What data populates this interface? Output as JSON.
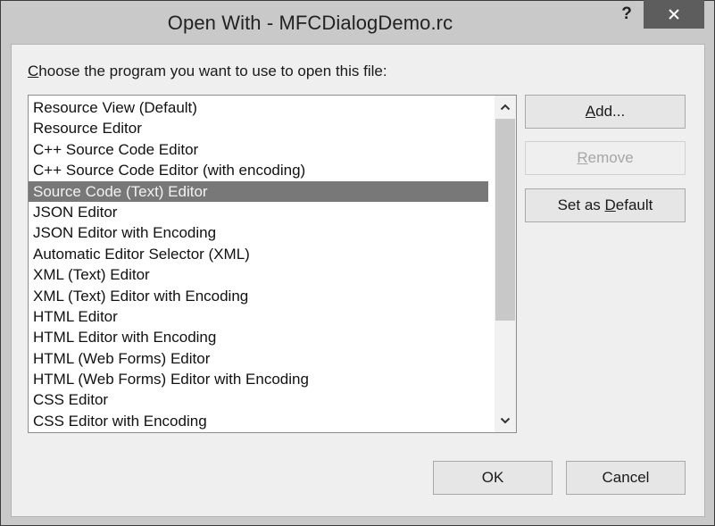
{
  "window": {
    "title": "Open With - MFCDialogDemo.rc",
    "help_label": "?",
    "close_icon": "close-icon"
  },
  "prompt": {
    "accelerator": "C",
    "rest": "hoose the program you want to use to open this file:"
  },
  "list": {
    "selected_index": 4,
    "items": [
      "Resource View (Default)",
      "Resource Editor",
      "C++ Source Code Editor",
      "C++ Source Code Editor (with encoding)",
      "Source Code (Text) Editor",
      "JSON Editor",
      "JSON Editor with Encoding",
      "Automatic Editor Selector (XML)",
      "XML (Text) Editor",
      "XML (Text) Editor with Encoding",
      "HTML Editor",
      "HTML Editor with Encoding",
      "HTML (Web Forms) Editor",
      "HTML (Web Forms) Editor with Encoding",
      "CSS Editor",
      "CSS Editor with Encoding"
    ],
    "scroll": {
      "up_icon": "chevron-up-icon",
      "down_icon": "chevron-down-icon",
      "thumb_start_fraction": 0.0,
      "visible_fraction": 0.7
    }
  },
  "buttons": {
    "add": {
      "accel": "A",
      "rest": "dd...",
      "enabled": true
    },
    "remove": {
      "accel": "R",
      "rest": "emove",
      "enabled": false
    },
    "set_default": {
      "pre": "Set as ",
      "accel": "D",
      "rest": "efault",
      "enabled": true
    },
    "ok": {
      "label": "OK"
    },
    "cancel": {
      "label": "Cancel"
    }
  },
  "colors": {
    "selection": "#787878",
    "close_button": "#5d5d5d",
    "frame": "#c9c9c9",
    "content": "#efefef"
  }
}
